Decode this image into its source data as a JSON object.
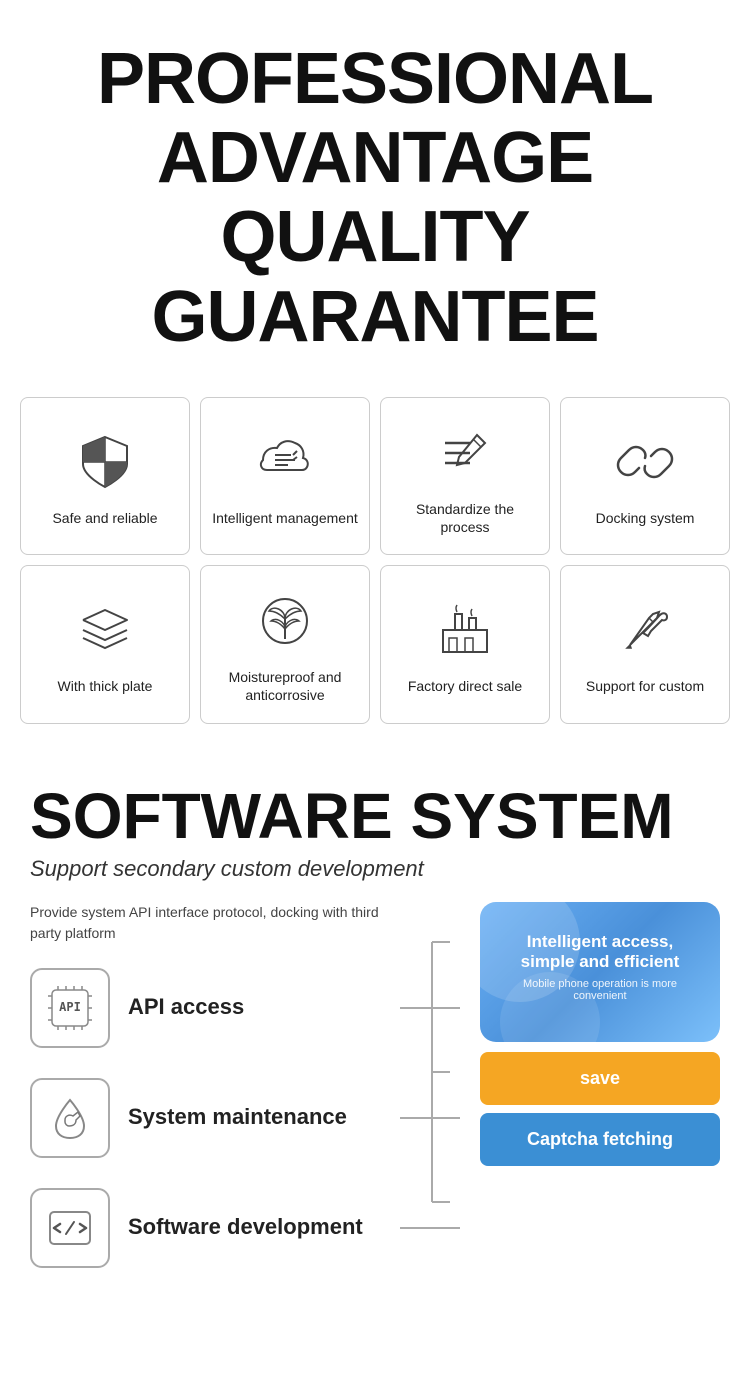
{
  "header": {
    "line1": "PROFESSIONAL",
    "line2": "ADVANTAGE",
    "line3": "QUALITY GUARANTEE"
  },
  "features_row1": [
    {
      "id": "safe-reliable",
      "label": "Safe and reliable",
      "icon": "shield"
    },
    {
      "id": "intelligent-management",
      "label": "Intelligent management",
      "icon": "cloud-settings"
    },
    {
      "id": "standardize-process",
      "label": "Standardize the process",
      "icon": "pen-lines"
    },
    {
      "id": "docking-system",
      "label": "Docking system",
      "icon": "link"
    }
  ],
  "features_row2": [
    {
      "id": "thick-plate",
      "label": "With thick plate",
      "icon": "layers"
    },
    {
      "id": "moistureproof",
      "label": "Moistureproof and anticorrosive",
      "icon": "shield-plant"
    },
    {
      "id": "factory-sale",
      "label": "Factory direct sale",
      "icon": "factory"
    },
    {
      "id": "support-custom",
      "label": "Support for custom",
      "icon": "pen-tool"
    }
  ],
  "software": {
    "title": "SOFTWARE SYSTEM",
    "subtitle": "Support secondary custom development",
    "description": "Provide system API interface protocol, docking with third party platform",
    "items": [
      {
        "id": "api-access",
        "label": "API access",
        "icon": "api"
      },
      {
        "id": "system-maintenance",
        "label": "System maintenance",
        "icon": "drop-wrench"
      },
      {
        "id": "software-development",
        "label": "Software development",
        "icon": "code"
      }
    ],
    "panel": {
      "title": "Intelligent access, simple and efficient",
      "subtitle": "Mobile phone operation is more convenient",
      "save_btn": "save",
      "captcha_btn": "Captcha fetching"
    }
  }
}
